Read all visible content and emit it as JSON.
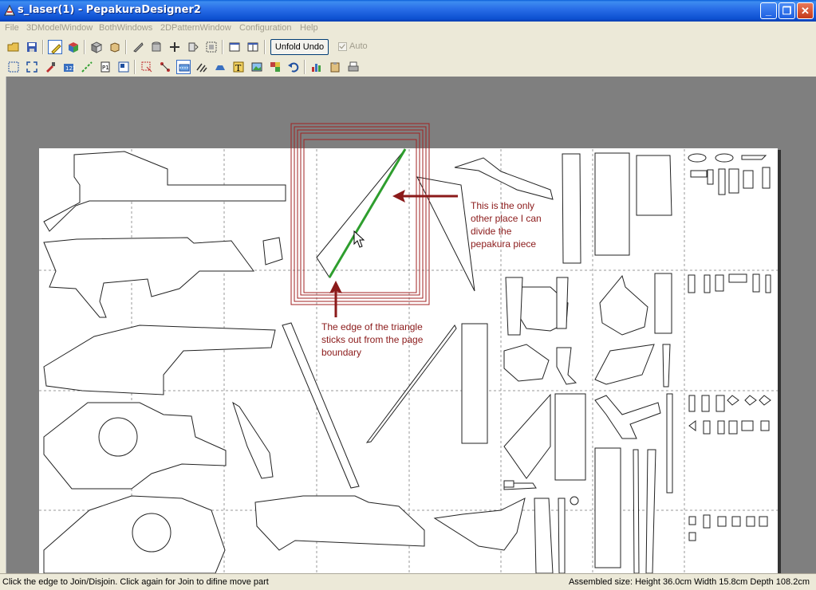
{
  "window": {
    "title": "s_laser(1) - PepakuraDesigner2",
    "minimize_glyph": "_",
    "maximize_glyph": "❐",
    "close_glyph": "✕"
  },
  "menu": {
    "items": [
      {
        "label": "File"
      },
      {
        "label": "3DModelWindow"
      },
      {
        "label": "BothWindows"
      },
      {
        "label": "2DPatternWindow"
      },
      {
        "label": "Configuration"
      },
      {
        "label": "Help"
      }
    ]
  },
  "toolbar": {
    "unfold_undo_label": "Unfold Undo",
    "auto_label": "Auto",
    "auto_checked": true
  },
  "annotations": {
    "divide_note": [
      "This is the only",
      "other place I can",
      "divide the",
      "pepakura piece"
    ],
    "edge_note": [
      "The edge of the triangle",
      "sticks out from the page",
      "boundary"
    ]
  },
  "status": {
    "hint": "Click the edge to Join/Disjoin. Click again for Join to difine move part",
    "assembled_size": "Assembled size: Height 36.0cm Width 15.8cm Depth 108.2cm"
  },
  "colors": {
    "annotation": "#8b1a1a",
    "selected_edge": "#2e9e2e",
    "page_frame": "#a02020",
    "title_bar": "#0c4fd0"
  }
}
